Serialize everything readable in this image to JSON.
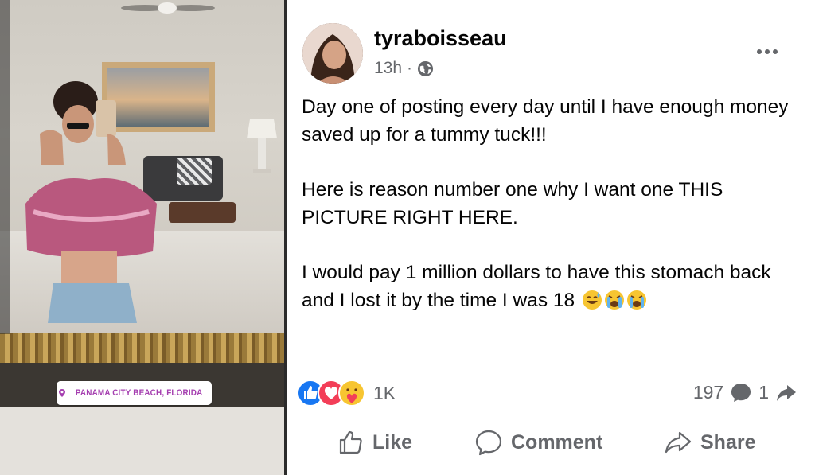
{
  "photo": {
    "location_sticker": "PANAMA CITY BEACH, FLORIDA"
  },
  "post": {
    "username": "tyraboisseau",
    "time": "13h",
    "separator": "·",
    "privacy_icon": "globe-icon",
    "paragraphs": [
      "Day one of posting every day until I have enough money saved up for a tummy tuck!!!",
      "Here is reason number one why I want one THIS PICTURE RIGHT HERE.",
      "I would pay 1 million dollars to have this stomach back and I lost it by the time I was 18"
    ],
    "trailing_emojis": [
      "sweat-smile-emoji",
      "crying-emoji",
      "crying-emoji"
    ],
    "reactions": {
      "icons": [
        "like-icon",
        "love-icon",
        "care-icon"
      ],
      "count": "1K"
    },
    "comments_count": "197",
    "shares_count": "1",
    "actions": {
      "like": "Like",
      "comment": "Comment",
      "share": "Share"
    }
  },
  "colors": {
    "like_blue": "#1877f2",
    "love_red": "#f33e58",
    "secondary_text": "#65676b",
    "location_purple": "#a53fb0"
  }
}
